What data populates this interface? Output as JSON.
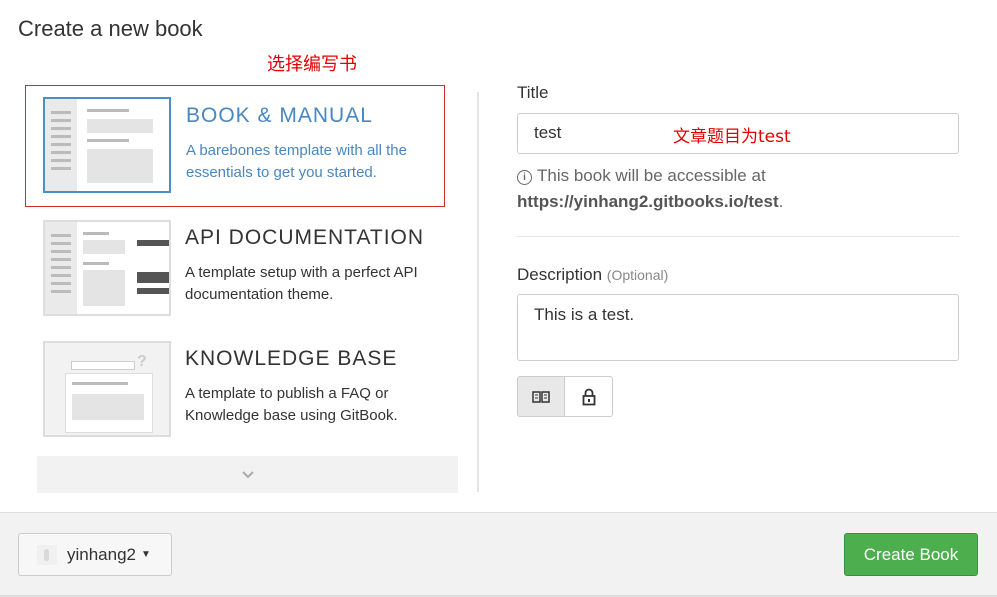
{
  "modal": {
    "title": "Create a new book"
  },
  "annotations": {
    "select_template": "选择编写书",
    "title_note": "文章题目为test"
  },
  "templates": [
    {
      "name": "BOOK & MANUAL",
      "description": "A barebones template with all the essentials to get you started.",
      "selected": true
    },
    {
      "name": "API DOCUMENTATION",
      "description": "A template setup with a perfect API documentation theme.",
      "selected": false
    },
    {
      "name": "KNOWLEDGE BASE",
      "description": "A template to publish a FAQ or Knowledge base using GitBook.",
      "selected": false
    }
  ],
  "more_icon": "chevron-down-icon",
  "form": {
    "title_label": "Title",
    "title_value": "test",
    "help_prefix": "This book will be accessible at",
    "help_url": "https://yinhang2.gitbooks.io/test",
    "help_suffix": ".",
    "description_label": "Description",
    "description_optional": "(Optional)",
    "description_value": "This is a test.",
    "visibility_icons": [
      "book-icon",
      "lock-icon"
    ]
  },
  "footer": {
    "owner": "yinhang2",
    "create_label": "Create Book"
  },
  "colors": {
    "accent": "#4a86bf",
    "create_button": "#4cae4c",
    "annotation": "#e00000"
  }
}
